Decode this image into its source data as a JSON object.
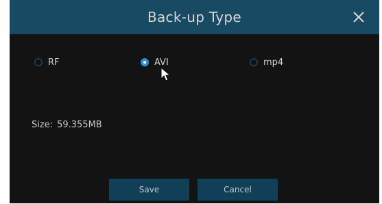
{
  "dialog": {
    "title": "Back-up Type",
    "close_icon": "close-icon",
    "options": [
      {
        "label": "RF",
        "checked": false
      },
      {
        "label": "AVI",
        "checked": true
      },
      {
        "label": "mp4",
        "checked": false
      }
    ],
    "size_label": "Size:",
    "size_value": "59.355MB",
    "save_label": "Save",
    "cancel_label": "Cancel"
  },
  "colors": {
    "title_bar": "#194a63",
    "panel": "#131313",
    "button": "#123f58",
    "radio_checked": "#2f8fd4"
  }
}
